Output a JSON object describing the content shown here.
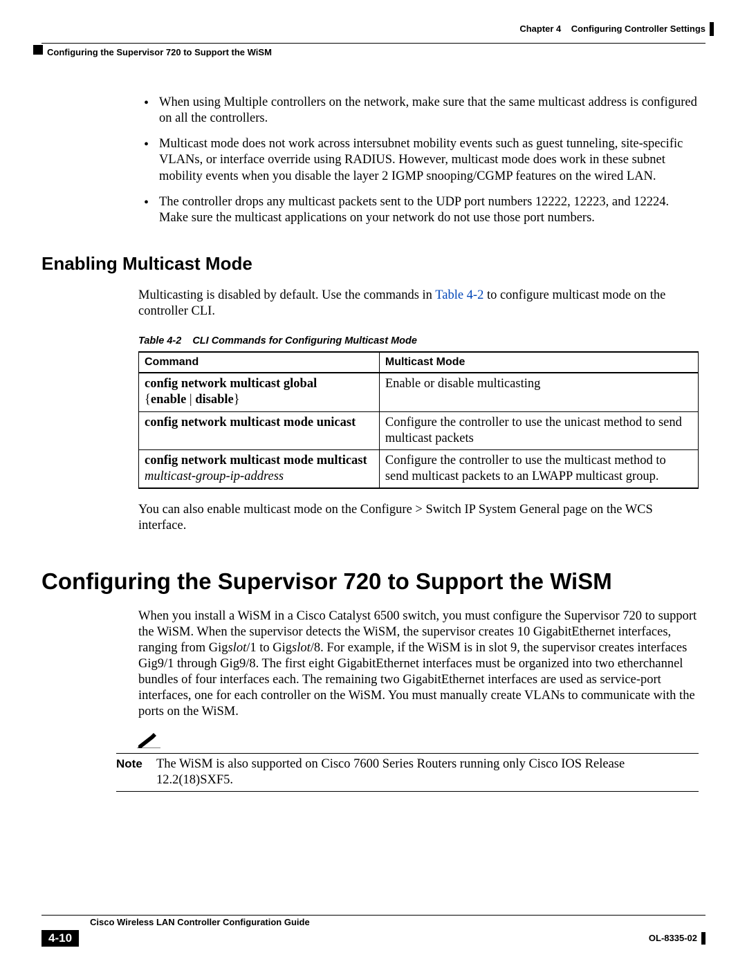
{
  "header": {
    "chapter": "Chapter 4",
    "chapter_title": "Configuring Controller Settings",
    "section_crumb": "Configuring the Supervisor 720 to Support the WiSM"
  },
  "bullets": [
    "When using Multiple controllers on the network, make sure that the same multicast address is configured on all the controllers.",
    "Multicast mode does not work across intersubnet mobility events such as guest tunneling, site-specific VLANs, or interface override using RADIUS. However, multicast mode does work in these subnet mobility events when you disable the layer 2 IGMP snooping/CGMP features on the wired LAN.",
    "The controller drops any multicast packets sent to the UDP port numbers 12222, 12223, and 12224. Make sure the multicast applications on your network do not use those port numbers."
  ],
  "section_enable": {
    "title": "Enabling Multicast Mode",
    "intro_a": "Multicasting is disabled by default. Use the commands in ",
    "intro_link": "Table 4-2",
    "intro_b": " to configure multicast mode on the controller CLI.",
    "after_table": "You can also enable multicast mode on the Configure > Switch IP System General page on the WCS interface."
  },
  "table": {
    "caption_num": "Table 4-2",
    "caption_text": "CLI Commands for Configuring Multicast Mode",
    "head_left": "Command",
    "head_right": "Multicast Mode",
    "rows": [
      {
        "cmd_html": "<span class=\"cmd-bold\">config network multicast global</span><br>{<span class=\"cmd-bold\">enable</span> | <span class=\"cmd-bold\">disable</span>}",
        "desc": "Enable or disable multicasting"
      },
      {
        "cmd_html": "<span class=\"cmd-bold\">config network multicast mode unicast</span>",
        "desc": "Configure the controller to use the unicast method to send multicast packets"
      },
      {
        "cmd_html": "<span class=\"cmd-bold\">config network multicast mode multicast</span><br><span class=\"cmd-ital\">multicast-group-ip-address</span>",
        "desc": "Configure the controller to use the multicast method to send multicast packets to an LWAPP multicast group."
      }
    ]
  },
  "section_sup": {
    "title": "Configuring the Supervisor 720 to Support the WiSM",
    "body_html": "When you install a WiSM in a Cisco Catalyst 6500 switch, you must configure the Supervisor 720 to support the WiSM. When the supervisor detects the WiSM, the supervisor creates 10 GigabitEthernet interfaces, ranging from Gig<i>slot</i>/1 to Gig<i>slot</i>/8. For example, if the WiSM is in slot 9, the supervisor creates interfaces Gig9/1 through Gig9/8. The first eight GigabitEthernet interfaces must be organized into two etherchannel bundles of four interfaces each. The remaining two GigabitEthernet interfaces are used as service-port interfaces, one for each controller on the WiSM. You must manually create VLANs to communicate with the ports on the WiSM."
  },
  "note": {
    "label": "Note",
    "text": "The WiSM is also supported on Cisco 7600 Series Routers running only Cisco IOS Release 12.2(18)SXF5."
  },
  "footer": {
    "guide": "Cisco Wireless LAN Controller Configuration Guide",
    "page": "4-10",
    "docid": "OL-8335-02"
  }
}
